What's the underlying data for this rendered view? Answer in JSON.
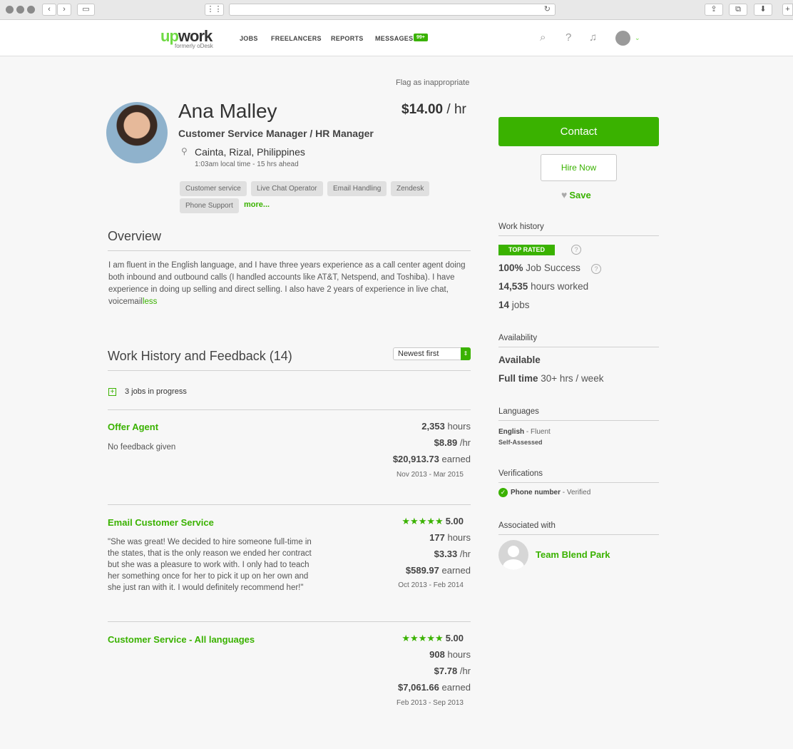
{
  "nav": {
    "logo_up": "up",
    "logo_work": "work",
    "logo_sub": "formerly oDesk",
    "links": [
      "JOBS",
      "FREELANCERS",
      "REPORTS",
      "MESSAGES"
    ],
    "messages_badge": "99+"
  },
  "profile": {
    "flag": "Flag as inappropriate",
    "name": "Ana Malley",
    "title": "Customer Service Manager / HR Manager",
    "location": "Cainta, Rizal, Philippines",
    "local_time": "1:03am local time - 15 hrs ahead",
    "rate_value": "$14.00",
    "rate_unit": "/ hr",
    "tags": [
      "Customer service",
      "Live Chat Operator",
      "Email Handling",
      "Zendesk",
      "Phone Support"
    ],
    "more": "more..."
  },
  "overview": {
    "heading": "Overview",
    "text": "I am fluent  in the English language, and I have three years experience as a call center agent doing both inbound and outbound calls (I handled accounts like AT&T, Netspend, and Toshiba). I have experience in doing up selling and direct selling. I also have 2 years of experience in live chat, voicemail",
    "less": "less"
  },
  "history": {
    "heading": "Work History and Feedback (14)",
    "sort": "Newest first",
    "in_progress": "3 jobs in progress",
    "jobs": [
      {
        "title": "Offer Agent",
        "feedback": "No feedback given",
        "hours_num": "2,353",
        "hours_label": "hours",
        "rate_num": "$8.89",
        "rate_label": "/hr",
        "earned_num": "$20,913.73",
        "earned_label": "earned",
        "dates": "Nov 2013 - Mar 2015"
      },
      {
        "title": "Email Customer Service",
        "stars": "★★★★★",
        "score": "5.00",
        "feedback": "\"She was great! We decided to hire someone full-time in the states, that is the only reason we ended her contract but she was a pleasure to work with. I only had to teach her something once for her to pick it up on her own and she just ran with it. I would definitely recommend her!\"",
        "hours_num": "177",
        "hours_label": "hours",
        "rate_num": "$3.33",
        "rate_label": "/hr",
        "earned_num": "$589.97",
        "earned_label": "earned",
        "dates": "Oct 2013 - Feb 2014"
      },
      {
        "title": "Customer Service - All languages",
        "stars": "★★★★★",
        "score": "5.00",
        "hours_num": "908",
        "hours_label": "hours",
        "rate_num": "$7.78",
        "rate_label": "/hr",
        "earned_num": "$7,061.66",
        "earned_label": "earned",
        "dates": "Feb 2013 - Sep 2013"
      }
    ]
  },
  "sidebar": {
    "contact": "Contact",
    "hire": "Hire Now",
    "save": "Save",
    "work_history": {
      "heading": "Work history",
      "badge": "TOP RATED",
      "job_success_num": "100%",
      "job_success_label": "Job Success",
      "hours_num": "14,535",
      "hours_label": "hours worked",
      "jobs_num": "14",
      "jobs_label": "jobs"
    },
    "availability": {
      "heading": "Availability",
      "status": "Available",
      "time_bold": "Full time",
      "time_rest": "30+ hrs / week"
    },
    "languages": {
      "heading": "Languages",
      "lang": "English",
      "level": "- Fluent",
      "assessed": "Self-Assessed"
    },
    "verifications": {
      "heading": "Verifications",
      "item": "Phone number",
      "status": "- Verified"
    },
    "associated": {
      "heading": "Associated with",
      "name": "Team Blend Park"
    }
  }
}
